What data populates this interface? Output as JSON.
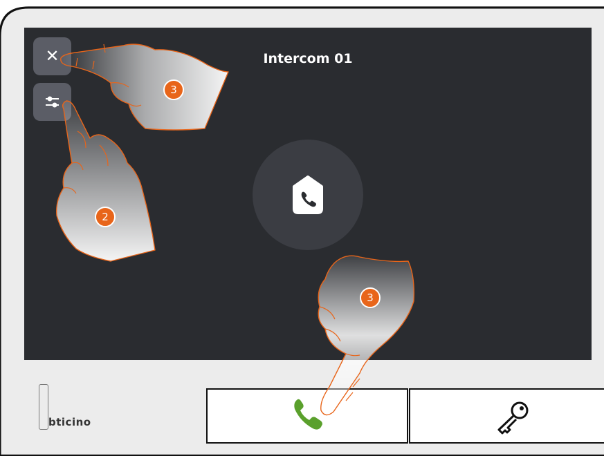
{
  "screen": {
    "title": "Intercom 01",
    "close_icon": "close-icon",
    "settings_icon": "sliders-icon",
    "center_icon": "home-phone-icon"
  },
  "device": {
    "brand": "bticino",
    "keys": [
      {
        "icon": "phone-icon",
        "color": "#5aa02c"
      },
      {
        "icon": "key-icon",
        "color": "#111111"
      }
    ]
  },
  "callouts": [
    {
      "number": "3"
    },
    {
      "number": "2"
    },
    {
      "number": "3"
    }
  ],
  "colors": {
    "screen_bg": "#2a2c30",
    "button_bg": "#5b5d66",
    "callout": "#e8651a",
    "call_green": "#5aa02c"
  }
}
